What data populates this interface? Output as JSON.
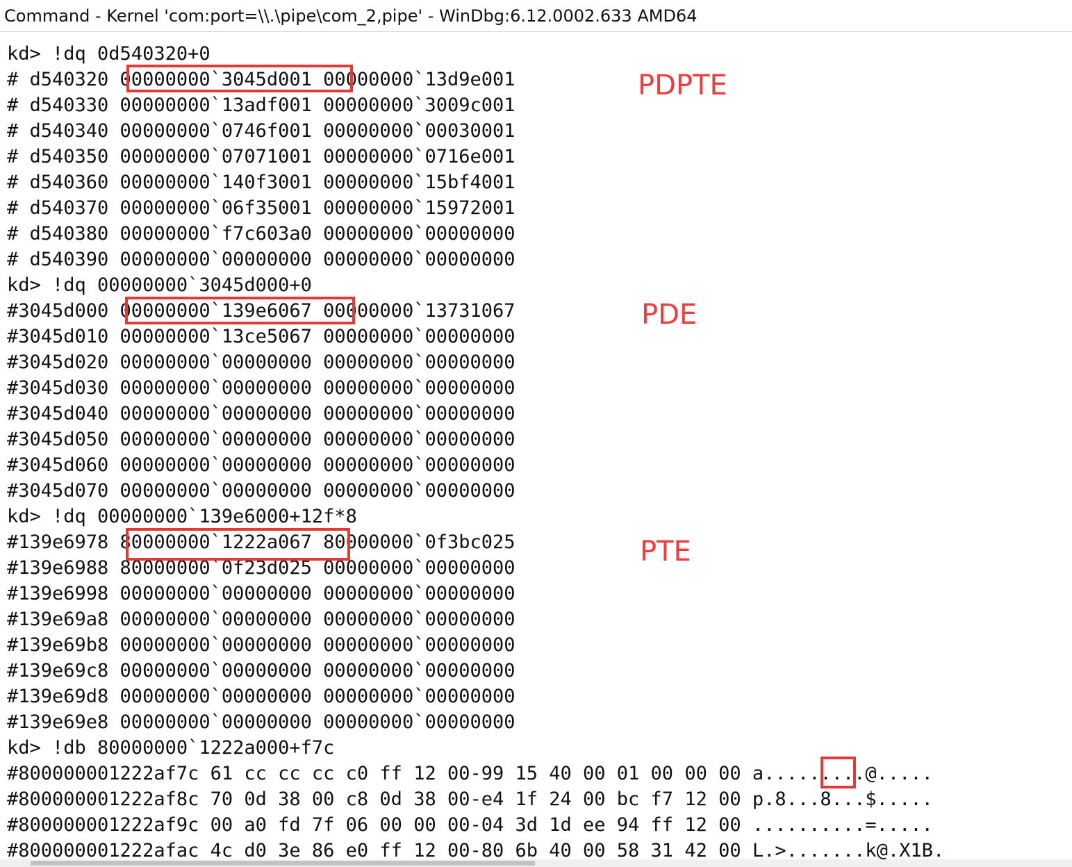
{
  "window": {
    "title": "Command - Kernel 'com:port=\\\\.\\pipe\\com_2,pipe' - WinDbg:6.12.0002.633 AMD64"
  },
  "annotations": {
    "pdpte": "PDPTE",
    "pde": "PDE",
    "pte": "PTE"
  },
  "colors": {
    "highlight": "#e53838",
    "annotation": "#ee3d3d",
    "text": "#111111"
  },
  "console": {
    "lines": [
      "kd> !dq 0d540320+0",
      "# d540320 00000000`3045d001 00000000`13d9e001",
      "# d540330 00000000`13adf001 00000000`3009c001",
      "# d540340 00000000`0746f001 00000000`00030001",
      "# d540350 00000000`07071001 00000000`0716e001",
      "# d540360 00000000`140f3001 00000000`15bf4001",
      "# d540370 00000000`06f35001 00000000`15972001",
      "# d540380 00000000`f7c603a0 00000000`00000000",
      "# d540390 00000000`00000000 00000000`00000000",
      "kd> !dq 00000000`3045d000+0",
      "#3045d000 00000000`139e6067 00000000`13731067",
      "#3045d010 00000000`13ce5067 00000000`00000000",
      "#3045d020 00000000`00000000 00000000`00000000",
      "#3045d030 00000000`00000000 00000000`00000000",
      "#3045d040 00000000`00000000 00000000`00000000",
      "#3045d050 00000000`00000000 00000000`00000000",
      "#3045d060 00000000`00000000 00000000`00000000",
      "#3045d070 00000000`00000000 00000000`00000000",
      "kd> !dq 00000000`139e6000+12f*8",
      "#139e6978 80000000`1222a067 80000000`0f3bc025",
      "#139e6988 80000000`0f23d025 00000000`00000000",
      "#139e6998 00000000`00000000 00000000`00000000",
      "#139e69a8 00000000`00000000 00000000`00000000",
      "#139e69b8 00000000`00000000 00000000`00000000",
      "#139e69c8 00000000`00000000 00000000`00000000",
      "#139e69d8 00000000`00000000 00000000`00000000",
      "#139e69e8 00000000`00000000 00000000`00000000",
      "kd> !db 80000000`1222a000+f7c",
      "#800000001222af7c 61 cc cc cc c0 ff 12 00-99 15 40 00 01 00 00 00 a.........@.....",
      "#800000001222af8c 70 0d 38 00 c8 0d 38 00-e4 1f 24 00 bc f7 12 00 p.8...8...$.....",
      "#800000001222af9c 00 a0 fd 7f 06 00 00 00-04 3d 1d ee 94 ff 12 00 ..........=.....",
      "#800000001222afac 4c d0 3e 86 e0 ff 12 00-80 6b 40 00 58 31 42 00 L.>.......k@.X1B."
    ]
  }
}
